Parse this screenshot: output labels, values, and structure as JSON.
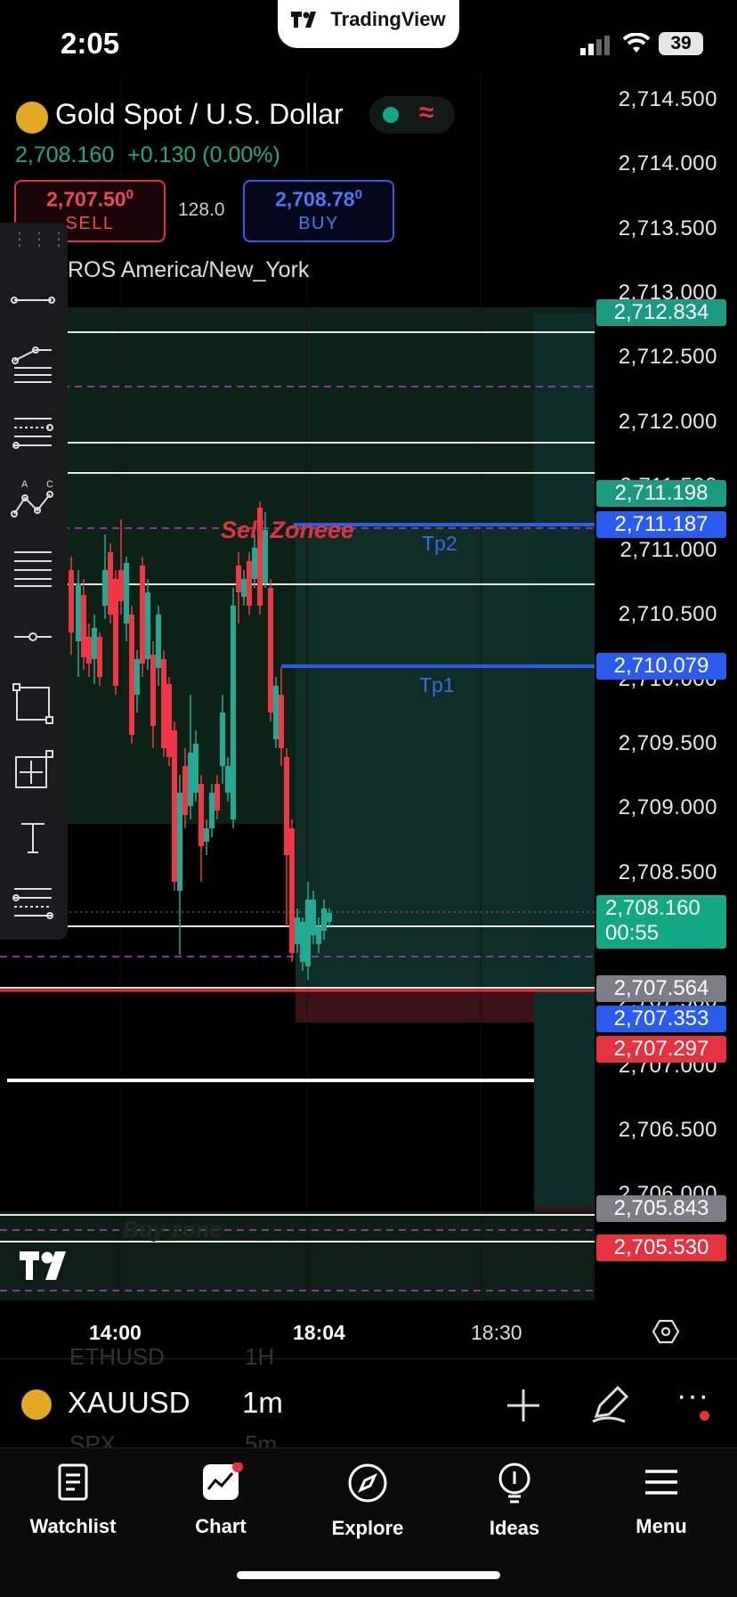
{
  "status_bar": {
    "time": "2:05",
    "battery": "39"
  },
  "brand": {
    "name": "TradingView"
  },
  "header": {
    "title": "Gold Spot / U.S. Dollar",
    "last_price": "2,708.160",
    "change": "+0.130 (0.00%)",
    "sell_price": "2,707.50",
    "sell_price_sup": "0",
    "sell_label": "SELL",
    "buy_price": "2,708.78",
    "buy_price_sup": "0",
    "buy_label": "BUY",
    "spread": "128.0",
    "session_text": "ROS America/New_York"
  },
  "price_axis": {
    "labels": [
      "2,714.500",
      "2,714.000",
      "2,713.500",
      "2,713.000",
      "2,712.500",
      "2,712.000",
      "2,711.500",
      "2,711.000",
      "2,710.500",
      "2,710.000",
      "2,709.500",
      "2,709.000",
      "2,708.500",
      "2,708.000",
      "2,707.500",
      "2,707.000",
      "2,706.500",
      "2,706.000"
    ]
  },
  "price_tags": [
    {
      "value": "2,712.834",
      "color": "#1a9a80"
    },
    {
      "value": "2,711.198",
      "color": "#1a9a80"
    },
    {
      "value": "2,711.187",
      "color": "#2b5cf0"
    },
    {
      "value": "2,710.079",
      "color": "#2b5cf0"
    },
    {
      "value": "2,708.160",
      "sub": "00:55",
      "color": "#12a884"
    },
    {
      "value": "2,707.564",
      "color": "#7d7d85"
    },
    {
      "value": "2,707.353",
      "color": "#2b5cf0"
    },
    {
      "value": "2,707.297",
      "color": "#e5323f"
    },
    {
      "value": "2,705.843",
      "color": "#7d7d85"
    },
    {
      "value": "2,705.530",
      "color": "#e5323f"
    }
  ],
  "annotations": {
    "sell_zone": "Sell Zoneee",
    "tp2": "Tp2",
    "tp1": "Tp1",
    "buy_zone": "Buy zone"
  },
  "time_axis": {
    "labels": [
      "14:00",
      "18:04",
      "18:30"
    ]
  },
  "symbol_bar": {
    "symbol": "XAUUSD",
    "interval": "1m",
    "ghost_above_symbol": "ETHUSD",
    "ghost_above_interval": "1H",
    "ghost_below_symbol": "SPX",
    "ghost_below_interval": "5m"
  },
  "nav": [
    {
      "label": "Watchlist",
      "icon": "watchlist-icon"
    },
    {
      "label": "Chart",
      "icon": "chart-icon"
    },
    {
      "label": "Explore",
      "icon": "compass-icon"
    },
    {
      "label": "Ideas",
      "icon": "lightbulb-icon"
    },
    {
      "label": "Menu",
      "icon": "menu-icon"
    }
  ],
  "colors": {
    "up": "#22ab94",
    "down": "#f23645",
    "accent_blue": "#2b5cf0",
    "background": "#000000"
  }
}
